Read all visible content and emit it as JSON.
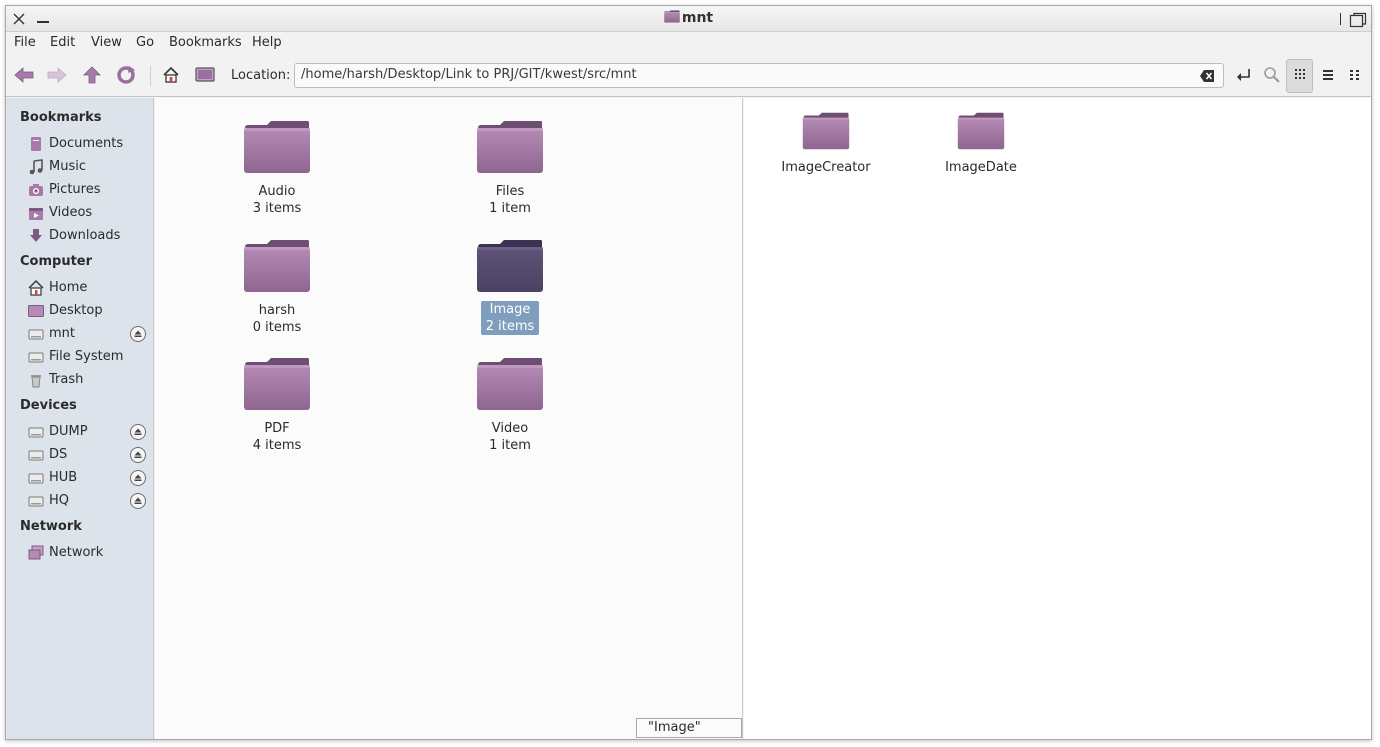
{
  "window": {
    "title": "mnt"
  },
  "menu": [
    "File",
    "Edit",
    "View",
    "Go",
    "Bookmarks",
    "Help"
  ],
  "location": {
    "label": "Location:",
    "path": "/home/harsh/Desktop/Link to PRJ/GIT/kwest/src/mnt"
  },
  "sidebar": {
    "bookmarks_heading": "Bookmarks",
    "bookmarks": [
      "Documents",
      "Music",
      "Pictures",
      "Videos",
      "Downloads"
    ],
    "computer_heading": "Computer",
    "computer": [
      "Home",
      "Desktop",
      "mnt",
      "File System",
      "Trash"
    ],
    "devices_heading": "Devices",
    "devices": [
      "DUMP",
      "DS",
      "HUB",
      "HQ"
    ],
    "network_heading": "Network",
    "network": [
      "Network"
    ]
  },
  "left_pane": {
    "folders": [
      {
        "name": "Audio",
        "count": "3 items"
      },
      {
        "name": "Files",
        "count": "1 item"
      },
      {
        "name": "harsh",
        "count": "0 items"
      },
      {
        "name": "Image",
        "count": "2 items"
      },
      {
        "name": "PDF",
        "count": "4 items"
      },
      {
        "name": "Video",
        "count": "1 item"
      }
    ]
  },
  "right_pane": {
    "folders": [
      {
        "name": "ImageCreator"
      },
      {
        "name": "ImageDate"
      }
    ]
  },
  "status": "\"Image\" selected (containing 2 items)",
  "colors": {
    "folder": "#9a6f9c",
    "folder_selected": "#5a4c6e",
    "selection": "#7f9dbc",
    "sidebar": "#dde3ea"
  }
}
